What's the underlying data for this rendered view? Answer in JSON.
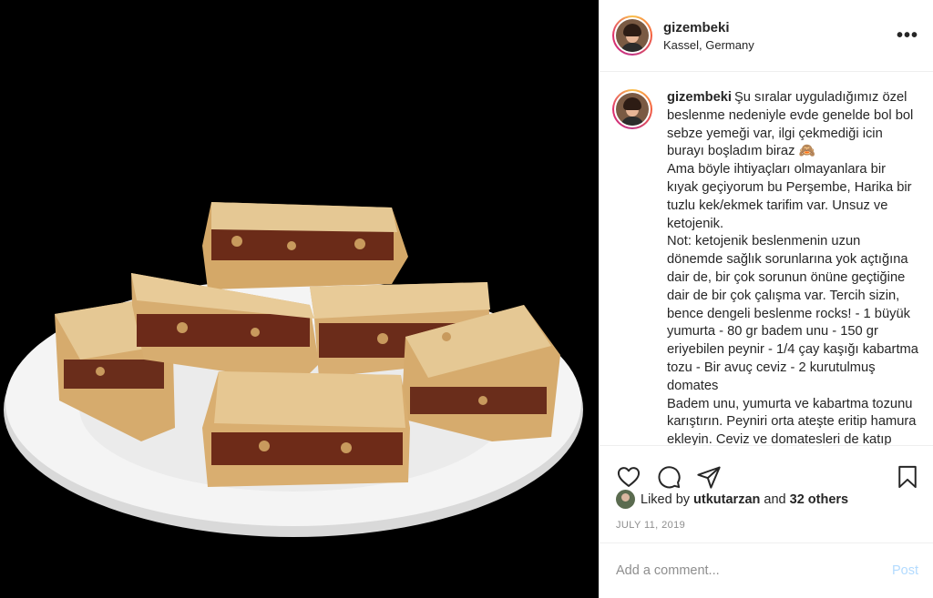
{
  "post": {
    "username": "gizembeki",
    "location": "Kassel, Germany",
    "more_icon": "more-options-icon",
    "caption_user": "gizembeki",
    "caption_lines": [
      "Şu sıralar uyguladığımız özel beslenme nedeniyle evde genelde bol bol sebze yemeği var, ilgi çekmediği icin burayı boşladım biraz 🙈",
      "Ama böyle ihtiyaçları olmayanlara bir kıyak geçiyorum bu Perşembe, Harika bir tuzlu kek/ekmek tarifim var. Unsuz ve ketojenik.",
      "Not: ketojenik beslenmenin uzun dönemde sağlık sorunlarına yok açtığına dair de, bir çok sorunun önüne geçtiğine dair de bir çok çalışma var. Tercih sizin, bence dengeli beslenme rocks! - 1 büyük yumurta - 80 gr badem unu - 150 gr eriyebilen peynir - 1/4 çay kaşığı kabartma tozu - Bir avuç ceviz - 2 kurutulmuş domates",
      "Badem unu, yumurta ve kabartma tozunu karıştırın. Peyniri orta ateşte eritip hamura ekleyin. Ceviz ve domatesleri de katıp tepsiye yayın."
    ],
    "likes": {
      "prefix": "Liked by",
      "user": "utkutarzan",
      "and_text": "and",
      "others": "32 others"
    },
    "date": "JULY 11, 2019",
    "comment_placeholder": "Add a comment...",
    "post_button": "Post",
    "icons": {
      "like": "heart-icon",
      "comment": "comment-icon",
      "share": "share-icon",
      "save": "bookmark-icon"
    }
  }
}
